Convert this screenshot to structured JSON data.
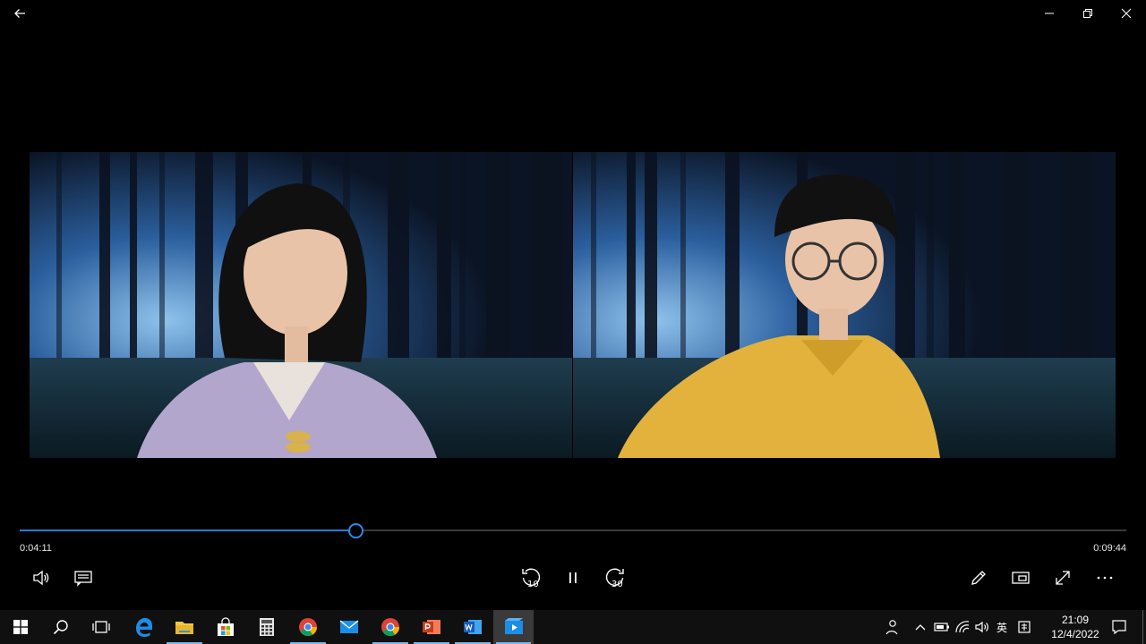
{
  "player": {
    "current_time": "0:04:11",
    "duration": "0:09:44",
    "progress": 0.303
  },
  "system_tray": {
    "ime_label": "英",
    "clock_time": "21:09",
    "clock_date": "12/4/2022"
  },
  "icons": {
    "back": "back-arrow-icon",
    "minimize": "minimize-icon",
    "restore": "restore-icon",
    "close": "close-icon",
    "volume": "volume-icon",
    "captions": "captions-icon",
    "skip_back": "skip-back-10-icon",
    "pause": "pause-icon",
    "skip_forward": "skip-forward-30-icon",
    "edit": "pen-icon",
    "mini_view": "mini-view-icon",
    "fullscreen": "fullscreen-icon",
    "more": "more-icon"
  },
  "skip": {
    "back_seconds": "10",
    "forward_seconds": "30"
  },
  "colors": {
    "accent": "#1e7fd6",
    "taskbar": "#101010",
    "forest_light": "#6fa8d8",
    "forest_dark": "#0b1424"
  }
}
